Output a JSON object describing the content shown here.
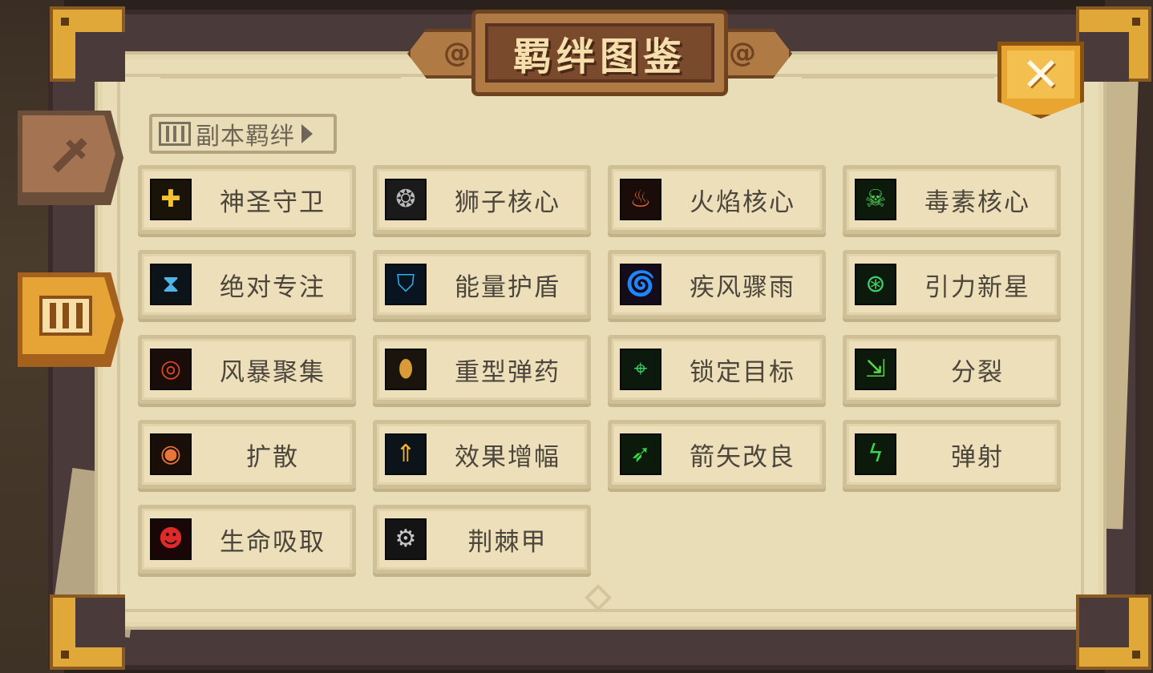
{
  "title": "羁绊图鉴",
  "close_icon": "close-icon",
  "side_tabs": [
    {
      "name": "weapon-tab",
      "icon": "sword-icon"
    },
    {
      "name": "bond-tab",
      "icon": "bond-gate-icon"
    }
  ],
  "subtab": {
    "label": "副本羁绊",
    "icon": "bond-gate-icon"
  },
  "colors": {
    "parchment": "#e9ddb8",
    "accent_gold": "#e6a437",
    "title_bg": "#7a4a2c",
    "label": "#4c463c"
  },
  "bonds": [
    {
      "label": "神圣守卫",
      "icon": "holy-shield-icon",
      "glyph": "✚",
      "fg": "#f2c230",
      "bg": "#1a1408"
    },
    {
      "label": "狮子核心",
      "icon": "lion-core-icon",
      "glyph": "❂",
      "fg": "#b8b8b8",
      "bg": "#1a1a1a"
    },
    {
      "label": "火焰核心",
      "icon": "flame-core-icon",
      "glyph": "♨",
      "fg": "#e8642a",
      "bg": "#1a0c08"
    },
    {
      "label": "毒素核心",
      "icon": "poison-core-icon",
      "glyph": "☠",
      "fg": "#52d95a",
      "bg": "#0c1a0c"
    },
    {
      "label": "绝对专注",
      "icon": "hourglass-icon",
      "glyph": "⧗",
      "fg": "#4fb3e8",
      "bg": "#0c141a"
    },
    {
      "label": "能量护盾",
      "icon": "energy-shield-icon",
      "glyph": "⛉",
      "fg": "#2fb0f0",
      "bg": "#081420"
    },
    {
      "label": "疾风骤雨",
      "icon": "whirlwind-icon",
      "glyph": "🌀",
      "fg": "#a54ad9",
      "bg": "#140c1a"
    },
    {
      "label": "引力新星",
      "icon": "gravity-nova-icon",
      "glyph": "⊛",
      "fg": "#3fd46a",
      "bg": "#0c1a0e"
    },
    {
      "label": "风暴聚集",
      "icon": "storm-gather-icon",
      "glyph": "◎",
      "fg": "#d94a2a",
      "bg": "#1a0c08"
    },
    {
      "label": "重型弹药",
      "icon": "heavy-ammo-icon",
      "glyph": "⬮",
      "fg": "#d99a3a",
      "bg": "#1a140c"
    },
    {
      "label": "锁定目标",
      "icon": "target-lock-icon",
      "glyph": "⌖",
      "fg": "#3ad46a",
      "bg": "#0c1a0e"
    },
    {
      "label": "分裂",
      "icon": "split-arrows-icon",
      "glyph": "⇲",
      "fg": "#5ad44a",
      "bg": "#0c1a0c"
    },
    {
      "label": "扩散",
      "icon": "spread-icon",
      "glyph": "◉",
      "fg": "#e8763a",
      "bg": "#1a0e08"
    },
    {
      "label": "效果增幅",
      "icon": "effect-boost-icon",
      "glyph": "⇑",
      "fg": "#f2b230",
      "bg": "#0c141a"
    },
    {
      "label": "箭矢改良",
      "icon": "arrow-upgrade-icon",
      "glyph": "➶",
      "fg": "#3ad44a",
      "bg": "#0c1a0c"
    },
    {
      "label": "弹射",
      "icon": "ricochet-icon",
      "glyph": "ϟ",
      "fg": "#3ad44a",
      "bg": "#0c1a0c"
    },
    {
      "label": "生命吸取",
      "icon": "life-steal-icon",
      "glyph": "☻",
      "fg": "#e02a2a",
      "bg": "#1a0606"
    },
    {
      "label": "荆棘甲",
      "icon": "thorn-armor-icon",
      "glyph": "⚙",
      "fg": "#c8c8c8",
      "bg": "#141414"
    }
  ]
}
